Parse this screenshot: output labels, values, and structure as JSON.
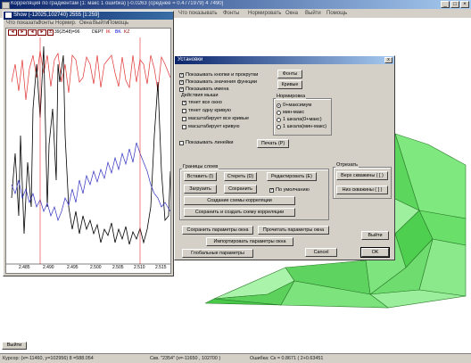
{
  "main_window": {
    "title": "Корреляция по градиентам (1: макс 1 ошибка) [-0.0263 (среднее = 0.4771979) 4 7490]",
    "menu": [
      "Что показывать",
      "Фонты",
      "Нормировать",
      "Окна",
      "Выйти",
      "Помощь"
    ]
  },
  "show_window": {
    "title": "Show (-12025,102740) 2555 [1:259]",
    "menu": [
      "Что показать",
      "Фонты",
      "Нормир.",
      "Окна",
      "Выйти",
      "Помощь"
    ],
    "scale_text": "1:1",
    "scale_value": "39(2548)=96",
    "curve_labels": [
      "DEPT",
      "IK",
      "BK",
      "KZ"
    ],
    "x_ticks": [
      "2.485",
      "2.490",
      "2.495",
      "2.500",
      "2.505",
      "2.510",
      "2.515"
    ]
  },
  "dialog": {
    "title": "Установки",
    "close": "x",
    "checks_top": [
      {
        "label": "Показывать кнопки и прокрутки",
        "checked": true
      },
      {
        "label": "Показывать значения функции",
        "checked": true
      },
      {
        "label": "Показывать имена",
        "checked": true
      }
    ],
    "fonts_button": "Фонты",
    "curves_button": "Кривые",
    "mouse_group": {
      "title": "Действия мыши",
      "items": [
        {
          "label": "тянет все окно",
          "checked": true
        },
        {
          "label": "тянет одну кривую",
          "checked": false
        },
        {
          "label": "масштабирует все кривые",
          "checked": false
        },
        {
          "label": "масштабирует кривую",
          "checked": false
        }
      ]
    },
    "norm_group": {
      "title": "Нормировка",
      "items": [
        {
          "label": "0+максимум",
          "selected": true
        },
        {
          "label": "мин-макс",
          "selected": false
        },
        {
          "label": "1 шкала(0+макс)",
          "selected": false
        },
        {
          "label": "1 шкала(мин-макс)",
          "selected": false
        }
      ]
    },
    "show_lines": {
      "label": "Показывать линейки",
      "checked": false
    },
    "print_button": "Печать (P)",
    "bounds_group": {
      "title": "Границы слоев",
      "insert": "Вставить (I)",
      "erase": "Стереть (D)",
      "edit": "Редактировать (E)",
      "load": "Загрузить",
      "save": "Сохранить",
      "default_label": "По умолчанию",
      "default_checked": true,
      "create_scheme": "Создание схемы корреляции",
      "save_and_create": "Сохранить и создать схему корреляции"
    },
    "cut_group": {
      "title": "Отрезать",
      "top": "Верх скважины ( [ )",
      "bottom": "Низ скважины ( ] )"
    },
    "save_params": "Сохранить параметры окна",
    "read_params": "Прочитать параметры окна",
    "import_params": "Импортировать параметры окна",
    "global_params": "Глобальные параметры",
    "cancel": "Cancel",
    "exit": "Выйти",
    "ok": "OK"
  },
  "taskbar": {
    "exit": "Выйти"
  },
  "status": {
    "left": "Курсор: (x=-11460, y=102956) 8 =588.054",
    "mid": "Скв. \"2354\" (x=-11650 , 102700 )",
    "right": "Ошибка: Ск = 0.8671 ( 2+0.63451"
  }
}
